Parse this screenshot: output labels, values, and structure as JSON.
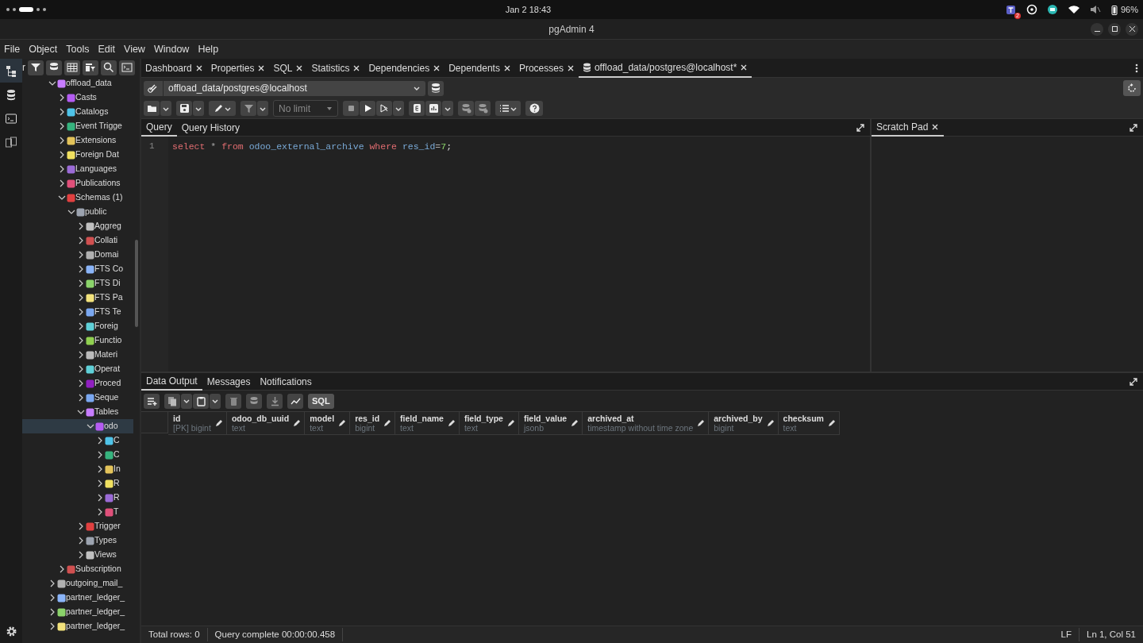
{
  "system_bar": {
    "datetime": "Jan 2 18:43",
    "notification_badge": "2",
    "battery": "96%"
  },
  "window": {
    "title": "pgAdmin 4"
  },
  "menu": [
    "File",
    "Object",
    "Tools",
    "Edit",
    "View",
    "Window",
    "Help"
  ],
  "explorer": {
    "title_fragment": "r",
    "tree": [
      {
        "label": "offload_data",
        "expanded": true,
        "selected": false,
        "children": [
          {
            "label": "Casts",
            "expanded": false,
            "selected": false
          },
          {
            "label": "Catalogs",
            "expanded": false,
            "selected": false
          },
          {
            "label": "Event Trigge",
            "expanded": false,
            "selected": false
          },
          {
            "label": "Extensions",
            "expanded": false,
            "selected": false
          },
          {
            "label": "Foreign Dat",
            "expanded": false,
            "selected": false
          },
          {
            "label": "Languages",
            "expanded": false,
            "selected": false
          },
          {
            "label": "Publications",
            "expanded": false,
            "selected": false
          },
          {
            "label": "Schemas (1)",
            "expanded": true,
            "selected": false,
            "children": [
              {
                "label": "public",
                "expanded": true,
                "selected": false,
                "children": [
                  {
                    "label": "Aggreg",
                    "expanded": false,
                    "selected": false
                  },
                  {
                    "label": "Collati",
                    "expanded": false,
                    "selected": false
                  },
                  {
                    "label": "Domai",
                    "expanded": false,
                    "selected": false
                  },
                  {
                    "label": "FTS Co",
                    "expanded": false,
                    "selected": false
                  },
                  {
                    "label": "FTS Di",
                    "expanded": false,
                    "selected": false
                  },
                  {
                    "label": "FTS Pa",
                    "expanded": false,
                    "selected": false
                  },
                  {
                    "label": "FTS Te",
                    "expanded": false,
                    "selected": false
                  },
                  {
                    "label": "Foreig",
                    "expanded": false,
                    "selected": false
                  },
                  {
                    "label": "Functio",
                    "expanded": false,
                    "selected": false
                  },
                  {
                    "label": "Materi",
                    "expanded": false,
                    "selected": false
                  },
                  {
                    "label": "Operat",
                    "expanded": false,
                    "selected": false
                  },
                  {
                    "label": "Proced",
                    "expanded": false,
                    "selected": false
                  },
                  {
                    "label": "Seque",
                    "expanded": false,
                    "selected": false
                  },
                  {
                    "label": "Tables",
                    "expanded": true,
                    "selected": false,
                    "children": [
                      {
                        "label": "odo",
                        "expanded": true,
                        "selected": true,
                        "children": [
                          {
                            "label": "C",
                            "expanded": false,
                            "selected": false
                          },
                          {
                            "label": "C",
                            "expanded": false,
                            "selected": false
                          },
                          {
                            "label": "In",
                            "expanded": false,
                            "selected": false
                          },
                          {
                            "label": "R",
                            "expanded": false,
                            "selected": false
                          },
                          {
                            "label": "R",
                            "expanded": false,
                            "selected": false
                          },
                          {
                            "label": "T",
                            "expanded": false,
                            "selected": false
                          }
                        ]
                      }
                    ]
                  },
                  {
                    "label": "Trigger",
                    "expanded": false,
                    "selected": false
                  },
                  {
                    "label": "Types",
                    "expanded": false,
                    "selected": false
                  },
                  {
                    "label": "Views",
                    "expanded": false,
                    "selected": false
                  }
                ]
              }
            ]
          },
          {
            "label": "Subscription",
            "expanded": false,
            "selected": false
          }
        ]
      },
      {
        "label": "outgoing_mail_",
        "expanded": false,
        "selected": false
      },
      {
        "label": "partner_ledger_",
        "expanded": false,
        "selected": false
      },
      {
        "label": "partner_ledger_",
        "expanded": false,
        "selected": false
      },
      {
        "label": "partner_ledger_",
        "expanded": false,
        "selected": false
      }
    ]
  },
  "tabs": [
    {
      "label": "Dashboard",
      "selected": false,
      "kind": "panel"
    },
    {
      "label": "Properties",
      "selected": false,
      "kind": "panel"
    },
    {
      "label": "SQL",
      "selected": false,
      "kind": "panel"
    },
    {
      "label": "Statistics",
      "selected": false,
      "kind": "panel"
    },
    {
      "label": "Dependencies",
      "selected": false,
      "kind": "panel"
    },
    {
      "label": "Dependents",
      "selected": false,
      "kind": "panel"
    },
    {
      "label": "Processes",
      "selected": false,
      "kind": "panel"
    },
    {
      "label": "offload_data/postgres@localhost*",
      "selected": true,
      "kind": "query"
    }
  ],
  "connection": {
    "value": "offload_data/postgres@localhost"
  },
  "query_toolbar": {
    "limit": "No limit"
  },
  "editor": {
    "tabs": [
      {
        "label": "Query",
        "selected": true
      },
      {
        "label": "Query History",
        "selected": false
      }
    ],
    "lines": [
      {
        "number": "1",
        "tokens": [
          {
            "text": "select ",
            "kind": "keyword"
          },
          {
            "text": "* ",
            "kind": "operator"
          },
          {
            "text": "from ",
            "kind": "keyword"
          },
          {
            "text": "odoo_external_archive ",
            "kind": "identifier"
          },
          {
            "text": "where ",
            "kind": "keyword"
          },
          {
            "text": "res_id",
            "kind": "identifier"
          },
          {
            "text": "=",
            "kind": "operator"
          },
          {
            "text": "7",
            "kind": "number"
          },
          {
            "text": ";",
            "kind": "plain"
          }
        ]
      }
    ]
  },
  "scratch_pad": {
    "tabs": [
      {
        "label": "Scratch Pad",
        "selected": true
      }
    ]
  },
  "output": {
    "tabs": [
      {
        "label": "Data Output",
        "selected": true
      },
      {
        "label": "Messages",
        "selected": false
      },
      {
        "label": "Notifications",
        "selected": false
      }
    ],
    "sql_button": "SQL",
    "columns": [
      {
        "name": "id",
        "type": "[PK] bigint"
      },
      {
        "name": "odoo_db_uuid",
        "type": "text"
      },
      {
        "name": "model",
        "type": "text"
      },
      {
        "name": "res_id",
        "type": "bigint"
      },
      {
        "name": "field_name",
        "type": "text"
      },
      {
        "name": "field_type",
        "type": "text"
      },
      {
        "name": "field_value",
        "type": "jsonb"
      },
      {
        "name": "archived_at",
        "type": "timestamp without time zone"
      },
      {
        "name": "archived_by",
        "type": "bigint"
      },
      {
        "name": "checksum",
        "type": "text"
      }
    ]
  },
  "status_bar": {
    "total_rows": "Total rows: 0",
    "message": "Query complete 00:00:00.458",
    "line_ending": "LF",
    "cursor": "Ln 1, Col 51"
  }
}
